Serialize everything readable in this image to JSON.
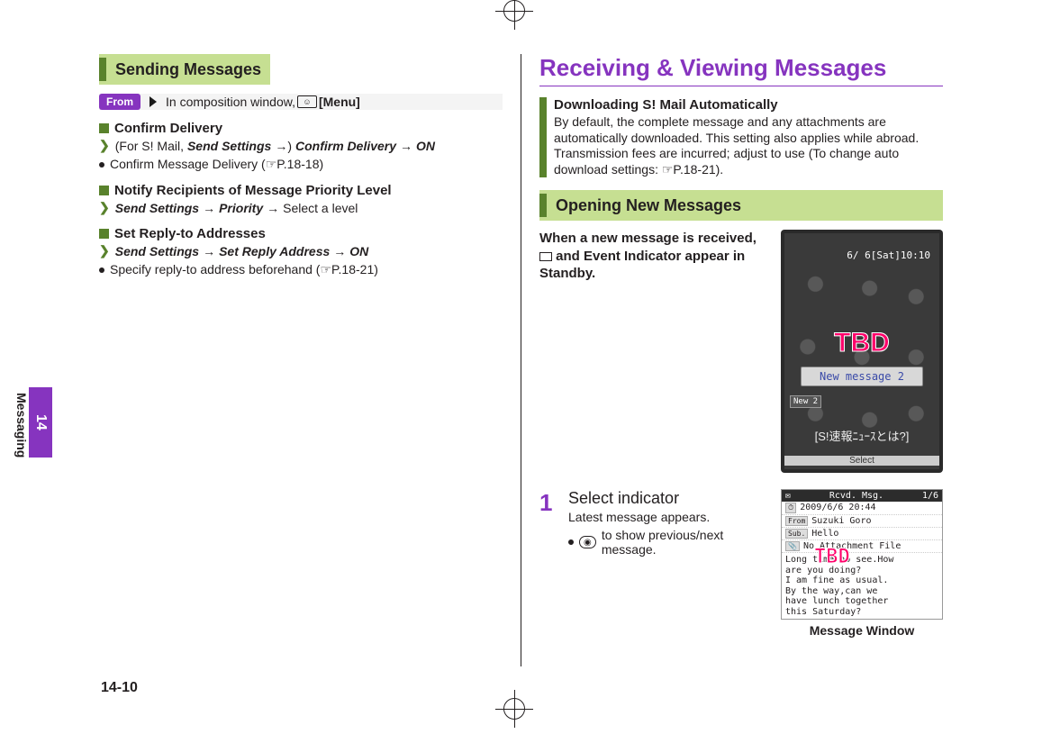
{
  "page_number": "14-10",
  "side_tab": {
    "number": "14",
    "label": "Messaging"
  },
  "left": {
    "section_title": "Sending Messages",
    "from_badge": "From",
    "from_text_a": "In composition window,",
    "from_menu_icon": "☺",
    "from_menu": "[Menu]",
    "items": [
      {
        "head": "Confirm Delivery",
        "path_prefix": "(For S! Mail,",
        "path_b1": "Send Settings",
        "path_arrow1": "→)",
        "path_b2": "Confirm Delivery",
        "path_arrow2": "→",
        "path_b3": "ON",
        "note": "Confirm Message Delivery (☞P.18-18)"
      },
      {
        "head": "Notify Recipients of Message Priority Level",
        "path_b1": "Send Settings",
        "path_arrow1": "→",
        "path_b2": "Priority",
        "path_arrow2": "→",
        "path_after": "Select a level"
      },
      {
        "head": "Set Reply-to Addresses",
        "path_b1": "Send Settings",
        "path_arrow1": "→",
        "path_b2": "Set Reply Address",
        "path_arrow2": "→",
        "path_b3": "ON",
        "note": "Specify reply-to address beforehand (☞P.18-21)"
      }
    ]
  },
  "right": {
    "title": "Receiving & Viewing Messages",
    "info": {
      "head": "Downloading S! Mail Automatically",
      "body": "By default, the complete message and any attachments are automatically downloaded. This setting also applies while abroad. Transmission fees are incurred; adjust to use (To change auto download settings: ☞P.18-21)."
    },
    "section_title": "Opening New Messages",
    "when": "When a new message is received,  and Event Indicator appear in Standby.",
    "phone": {
      "date": "6/ 6[Sat]10:10",
      "tbd": "TBD",
      "popup": "New message 2",
      "new_badge": "New 2",
      "jp": "[S!速報ﾆｭｰｽとは?]",
      "softkey": "Select"
    },
    "step": {
      "num": "1",
      "head": "Select indicator",
      "sub": "Latest message appears.",
      "note": "to show previous/next message."
    },
    "msg": {
      "title_left": "Rcvd. Msg.",
      "title_right": "1/6",
      "date": "2009/6/6 20:44",
      "from_label": "From",
      "from": "Suzuki Goro",
      "sub_label": "Sub.",
      "sub": "Hello",
      "attach": "No Attachment File",
      "tbd": "TBD",
      "body": "Long time no see.How\nare you doing?\nI am fine as usual.\nBy the way,can we\nhave lunch together\nthis Saturday?",
      "caption": "Message Window"
    }
  }
}
